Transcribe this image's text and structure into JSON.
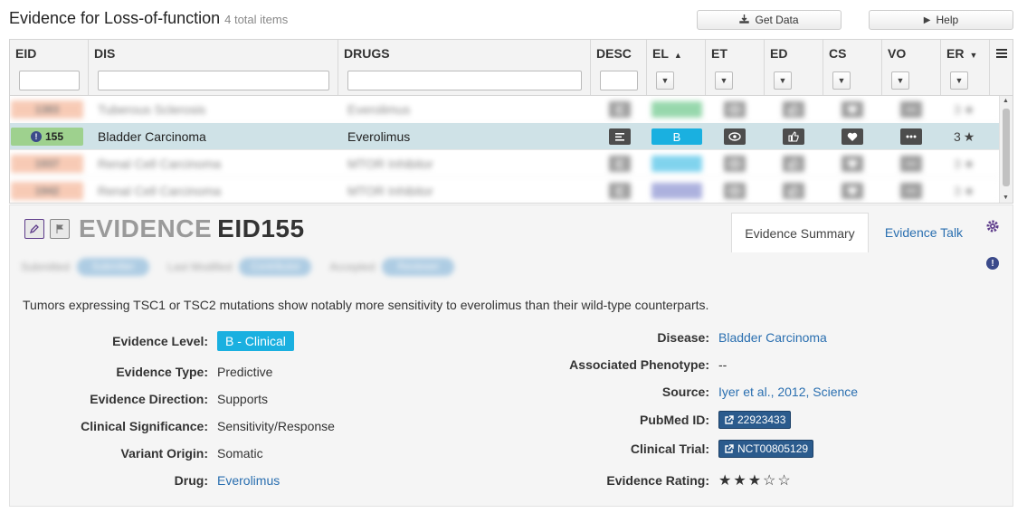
{
  "header": {
    "title": "Evidence for Loss-of-function",
    "count": "4 total items"
  },
  "toolbar": {
    "get_data": "Get Data",
    "help": "Help"
  },
  "grid": {
    "columns": [
      {
        "key": "eid",
        "label": "EID",
        "filter": "input",
        "sort": ""
      },
      {
        "key": "dis",
        "label": "DIS",
        "filter": "input",
        "sort": ""
      },
      {
        "key": "drugs",
        "label": "DRUGS",
        "filter": "input",
        "sort": ""
      },
      {
        "key": "desc",
        "label": "DESC",
        "filter": "input",
        "sort": ""
      },
      {
        "key": "el",
        "label": "EL",
        "filter": "select",
        "sort": "▲"
      },
      {
        "key": "et",
        "label": "ET",
        "filter": "select",
        "sort": ""
      },
      {
        "key": "ed",
        "label": "ED",
        "filter": "select",
        "sort": ""
      },
      {
        "key": "cs",
        "label": "CS",
        "filter": "select",
        "sort": ""
      },
      {
        "key": "vo",
        "label": "VO",
        "filter": "select",
        "sort": ""
      },
      {
        "key": "er",
        "label": "ER",
        "filter": "select",
        "sort": "▼"
      }
    ],
    "rows": [
      {
        "eid": "1383",
        "dis": "Tuberous Sclerosis",
        "drugs": "Everolimus",
        "el_color": "#43b86a",
        "er": "3",
        "selected": false,
        "blurred": true
      },
      {
        "eid": "155",
        "dis": "Bladder Carcinoma",
        "drugs": "Everolimus",
        "el": "B",
        "el_color": "#1ab0e0",
        "er": "3",
        "selected": true,
        "blurred": false
      },
      {
        "eid": "1937",
        "dis": "Renal Cell Carcinoma",
        "drugs": "MTOR Inhibitor",
        "el_color": "#1ab0e0",
        "er": "3",
        "selected": false,
        "blurred": true
      },
      {
        "eid": "1942",
        "dis": "Renal Cell Carcinoma",
        "drugs": "MTOR Inhibitor",
        "el_color": "#6a73c4",
        "er": "3",
        "selected": false,
        "blurred": true
      }
    ]
  },
  "evidence": {
    "title_label": "EVIDENCE",
    "title_id": "EID155",
    "tabs": {
      "summary": "Evidence Summary",
      "talk": "Evidence Talk"
    },
    "meta": [
      {
        "label": "Submitted",
        "value": "Submitter"
      },
      {
        "label": "Last Modified",
        "value": "Contributor"
      },
      {
        "label": "Accepted",
        "value": "Reviewer"
      }
    ],
    "description": "Tumors expressing TSC1 or TSC2 mutations show notably more sensitivity to everolimus than their wild-type counterparts.",
    "left": {
      "evidence_level_label": "Evidence Level:",
      "evidence_level": "B - Clinical",
      "evidence_type_label": "Evidence Type:",
      "evidence_type": "Predictive",
      "evidence_direction_label": "Evidence Direction:",
      "evidence_direction": "Supports",
      "clinical_significance_label": "Clinical Significance:",
      "clinical_significance": "Sensitivity/Response",
      "variant_origin_label": "Variant Origin:",
      "variant_origin": "Somatic",
      "drug_label": "Drug:",
      "drug": "Everolimus"
    },
    "right": {
      "disease_label": "Disease:",
      "disease": "Bladder Carcinoma",
      "phenotype_label": "Associated Phenotype:",
      "phenotype": "--",
      "source_label": "Source:",
      "source": "Iyer et al., 2012, Science",
      "pubmed_label": "PubMed ID:",
      "pubmed": "22923433",
      "trial_label": "Clinical Trial:",
      "trial": "NCT00805129",
      "rating_label": "Evidence Rating:",
      "rating": 3,
      "rating_max": 5
    }
  },
  "colors": {
    "accent": "#2a6fb0",
    "selected_row": "#cfe2e7",
    "eid_badge": "#9ed18e",
    "el_b": "#1ab0e0",
    "purple": "#5d3b8a"
  }
}
